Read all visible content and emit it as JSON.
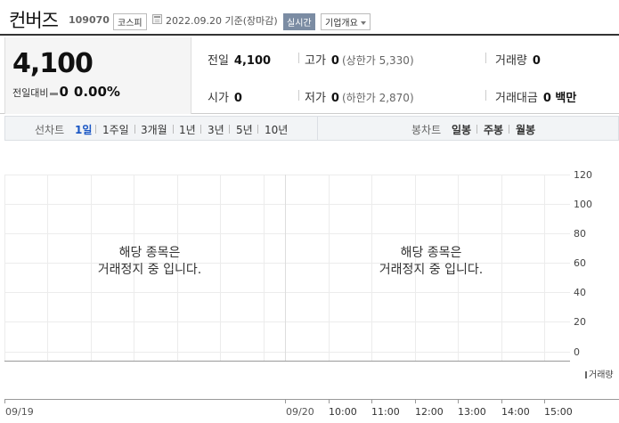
{
  "stock": {
    "name": "컨버즈",
    "code": "109070",
    "market": "코스피",
    "date_text": "2022.09.20 기준(장마감)",
    "realtime_label": "실시간",
    "info_button": "기업개요"
  },
  "summary": {
    "price": "4,100",
    "change_label": "전일대비",
    "change_value": "0",
    "change_rate": "0.00%",
    "prev_close_label": "전일",
    "prev_close": "4,100",
    "high_label": "고가",
    "high": "0",
    "upper_limit": "(상한가 5,330)",
    "volume_label": "거래량",
    "volume": "0",
    "open_label": "시가",
    "open": "0",
    "low_label": "저가",
    "low": "0",
    "lower_limit": "(하한가 2,870)",
    "amount_label": "거래대금",
    "amount": "0 백만"
  },
  "tabs": {
    "line_chart_label": "선차트",
    "periods": [
      "1일",
      "1주일",
      "3개월",
      "1년",
      "3년",
      "5년",
      "10년"
    ],
    "active_period": "1일",
    "candle_chart_label": "봉차트",
    "candles": [
      "일봉",
      "주봉",
      "월봉"
    ]
  },
  "chart": {
    "y_ticks": [
      "120",
      "100",
      "80",
      "60",
      "40",
      "20",
      "0"
    ],
    "notice_line1": "해당 종목은",
    "notice_line2": "거래정지 중 입니다.",
    "volume_label": "거래량",
    "x_labels": [
      "09/19",
      "09/20",
      "10:00",
      "11:00",
      "12:00",
      "13:00",
      "14:00",
      "15:00"
    ]
  },
  "colors": {
    "active_tab": "#1a56c4",
    "realtime_badge": "#7b8ca3"
  }
}
